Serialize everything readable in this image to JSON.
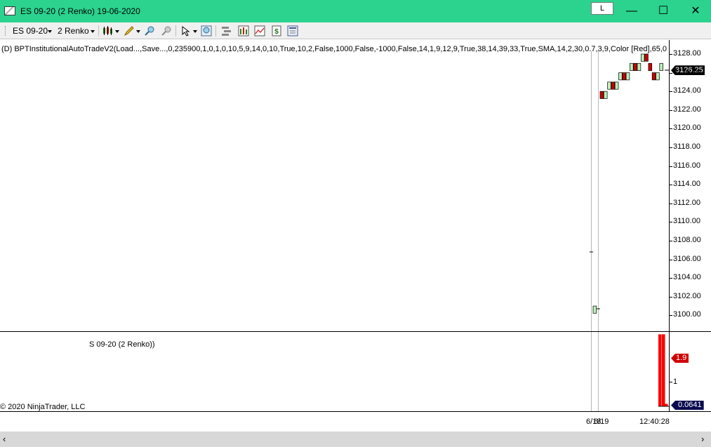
{
  "window": {
    "title": "ES 09-20 (2 Renko)  19-06-2020",
    "l_button": "L",
    "minimize": "—",
    "maximize": "☐",
    "close": "✕"
  },
  "toolbar": {
    "instrument": "ES 09-20",
    "bar_type": "2 Renko"
  },
  "price_panel": {
    "indicator_label": "(D) BPTInstitutionalAutoTradeV2(Load...,Save...,0,235900,1,0,1,0,10,5,9,14,0,10,True,10,2,False,1000,False,-1000,False,14,1,9,12,9,True,38,14,39,33,True,SMA,14,2,30,0.7,3,9,Color [Red],65,0",
    "y_ticks": [
      "3128.00",
      "3126.00",
      "3124.00",
      "3122.00",
      "3120.00",
      "3118.00",
      "3116.00",
      "3114.00",
      "3112.00",
      "3110.00",
      "3108.00",
      "3106.00",
      "3104.00",
      "3102.00",
      "3100.00"
    ],
    "last_price": "3126.25"
  },
  "lower_panel": {
    "label": "S 09-20 (2 Renko))",
    "copyright": "© 2020 NinjaTrader, LLC",
    "y_tick": "1",
    "upper_value": "1.9",
    "lower_value": "0.0641"
  },
  "x_axis": {
    "labels": [
      "6/18",
      "6/19",
      "12:40:28"
    ]
  },
  "chart_data": {
    "type": "renko",
    "brick_size": 1,
    "ylim": [
      3099,
      3128.5
    ],
    "bricks": [
      {
        "open": 3100,
        "close": 3101,
        "dir": "up"
      },
      {
        "open": 3124,
        "close": 3123,
        "dir": "down"
      },
      {
        "open": 3123,
        "close": 3124,
        "dir": "up"
      },
      {
        "open": 3124,
        "close": 3125,
        "dir": "up"
      },
      {
        "open": 3125,
        "close": 3124,
        "dir": "down"
      },
      {
        "open": 3124,
        "close": 3125,
        "dir": "up"
      },
      {
        "open": 3125,
        "close": 3126,
        "dir": "up"
      },
      {
        "open": 3126,
        "close": 3125,
        "dir": "down"
      },
      {
        "open": 3125,
        "close": 3126,
        "dir": "up"
      },
      {
        "open": 3126,
        "close": 3127,
        "dir": "up"
      },
      {
        "open": 3127,
        "close": 3126,
        "dir": "down"
      },
      {
        "open": 3126,
        "close": 3127,
        "dir": "up"
      },
      {
        "open": 3127,
        "close": 3128,
        "dir": "up"
      },
      {
        "open": 3128,
        "close": 3127,
        "dir": "down"
      },
      {
        "open": 3127,
        "close": 3126,
        "dir": "down"
      },
      {
        "open": 3126,
        "close": 3125,
        "dir": "down"
      },
      {
        "open": 3125,
        "close": 3126,
        "dir": "up"
      },
      {
        "open": 3126,
        "close": 3127,
        "dir": "up"
      }
    ],
    "colors": {
      "up": "#b9f0b9",
      "down": "#cc0000",
      "histogram": "#ff0000"
    },
    "lower_histogram": [
      1.9,
      1.9,
      0.0641
    ]
  }
}
